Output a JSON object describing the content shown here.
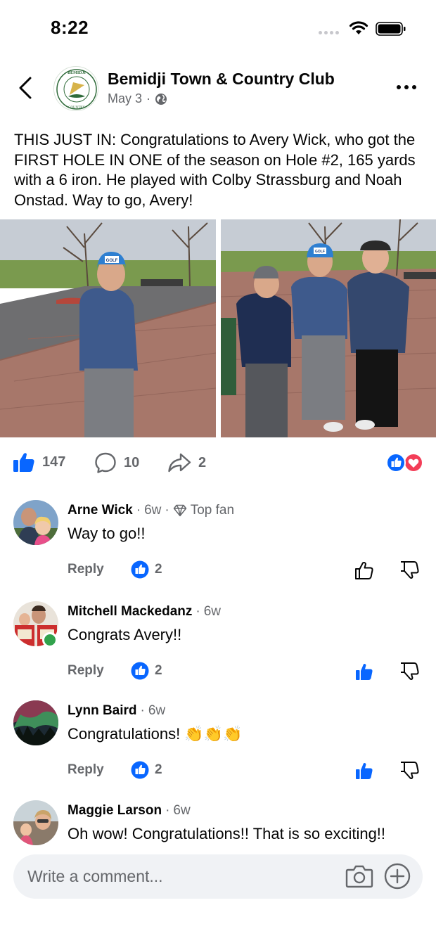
{
  "status_bar": {
    "time": "8:22"
  },
  "post": {
    "author": "Bemidji Town & Country Club",
    "date": "May 3",
    "meta_separator": "·",
    "text": "THIS JUST IN:  Congratulations to Avery Wick, who got the FIRST HOLE IN ONE of the season on Hole #2, 165 yards with a 6 iron.  He played with Colby Strassburg and Noah Onstad.  Way to go, Avery!",
    "logo_text": "BEMIDJI TOWN & COUNTRY CLUB",
    "photo_left_cap_text": "GOLF",
    "photo_right_cap_text": "GOLF"
  },
  "reactions": {
    "likes": "147",
    "comments": "10",
    "shares": "2",
    "reaction_types": [
      "like",
      "love"
    ]
  },
  "comments": [
    {
      "name": "Arne Wick",
      "age": "6w",
      "badge": "Top fan",
      "text": "Way to go!!",
      "reply_label": "Reply",
      "likes": "2",
      "user_liked": false,
      "online": false
    },
    {
      "name": "Mitchell Mackedanz",
      "age": "6w",
      "badge": "",
      "text": "Congrats Avery!!",
      "reply_label": "Reply",
      "likes": "2",
      "user_liked": true,
      "online": true
    },
    {
      "name": "Lynn Baird",
      "age": "6w",
      "badge": "",
      "text": "Congratulations! 👏👏👏",
      "reply_label": "Reply",
      "likes": "2",
      "user_liked": true,
      "online": false
    },
    {
      "name": "Maggie Larson",
      "age": "6w",
      "badge": "",
      "text": "Oh wow! Congratulations!! That is so exciting!!",
      "reply_label": "Reply",
      "likes": "",
      "user_liked": false,
      "online": false
    }
  ],
  "composer": {
    "placeholder": "Write a comment..."
  },
  "colors": {
    "accent": "#0866ff",
    "secondary_text": "#65676b",
    "love": "#f33e58",
    "online": "#31a24c"
  },
  "icons": [
    "back-icon",
    "globe-icon",
    "more-icon",
    "like-icon",
    "comment-icon",
    "share-icon",
    "thumbs-up-icon",
    "thumbs-down-icon",
    "camera-icon",
    "plus-icon",
    "wifi-icon",
    "battery-icon",
    "diamond-icon"
  ]
}
